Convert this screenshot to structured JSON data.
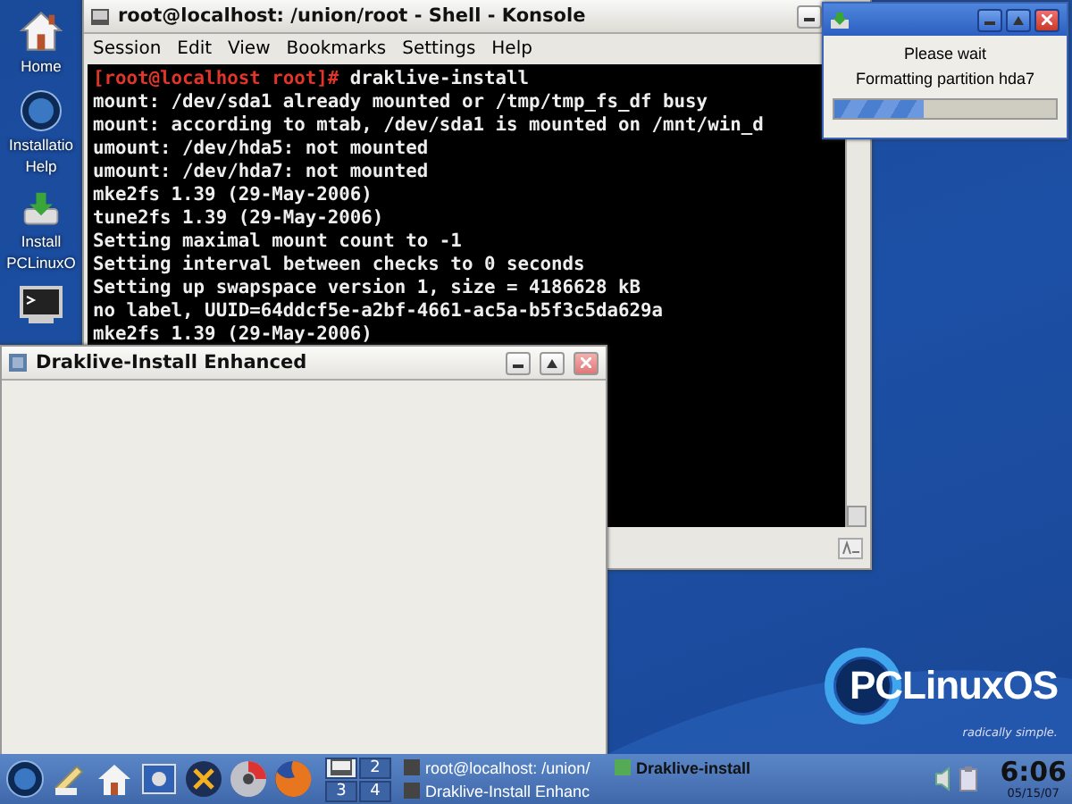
{
  "desktop_icons": [
    {
      "kind": "home",
      "lines": [
        "Home"
      ]
    },
    {
      "kind": "help",
      "lines": [
        "Installatio",
        "Help"
      ]
    },
    {
      "kind": "install",
      "lines": [
        "Install",
        "PCLinuxO"
      ]
    },
    {
      "kind": "terminal"
    }
  ],
  "konsole": {
    "title": "root@localhost: /union/root - Shell - Konsole",
    "menu": [
      "Session",
      "Edit",
      "View",
      "Bookmarks",
      "Settings",
      "Help"
    ],
    "lines": [
      {
        "prompt": "[root@localhost root]#",
        "text": " draklive-install"
      },
      {
        "text": "mount: /dev/sda1 already mounted or /tmp/tmp_fs_df busy"
      },
      {
        "text": "mount: according to mtab, /dev/sda1 is mounted on /mnt/win_d"
      },
      {
        "text": "umount: /dev/hda5: not mounted"
      },
      {
        "text": "umount: /dev/hda7: not mounted"
      },
      {
        "text": "mke2fs 1.39 (29-May-2006)"
      },
      {
        "text": "tune2fs 1.39 (29-May-2006)"
      },
      {
        "text": "Setting maximal mount count to -1"
      },
      {
        "text": "Setting interval between checks to 0 seconds"
      },
      {
        "text": "Setting up swapspace version 1, size = 4186628 kB"
      },
      {
        "text": "no label, UUID=64ddcf5e-a2bf-4661-ac5a-b5f3c5da629a"
      },
      {
        "text": "mke2fs 1.39 (29-May-2006)"
      }
    ]
  },
  "draklive_window": {
    "title": "Draklive-Install Enhanced"
  },
  "progress_dialog": {
    "messages": [
      "Please wait",
      "Formatting partition hda7"
    ],
    "level": 0.4
  },
  "logo": {
    "name": "PCLinuxOS",
    "tagline": "radically simple."
  },
  "taskbar": {
    "desktops": [
      {
        "selected": true
      },
      {
        "label": "2",
        "selected": false
      },
      {
        "label": "3",
        "selected": false
      },
      {
        "label": "4",
        "selected": false
      }
    ],
    "tasks": [
      {
        "label": "root@localhost: /union/",
        "active": false
      },
      {
        "label": "Draklive-Install Enhanc",
        "active": false
      },
      {
        "label": "Draklive-install",
        "active": true
      }
    ],
    "clock": {
      "time": "6:06",
      "date": "05/15/07"
    }
  }
}
